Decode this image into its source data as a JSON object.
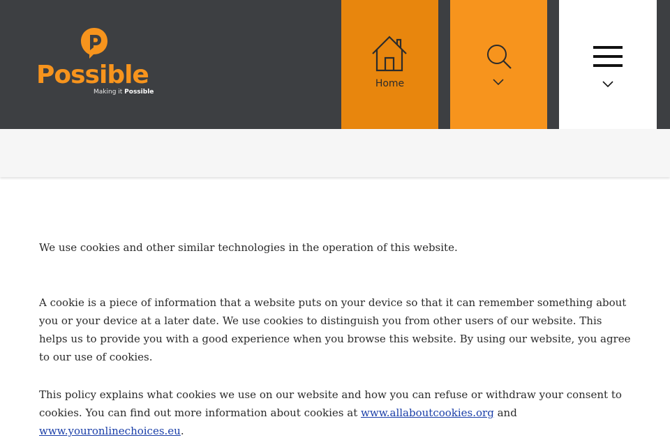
{
  "brand": {
    "name": "Possible",
    "tagline_prefix": "Making it ",
    "tagline_bold": "Possible",
    "color_primary": "#f7941d",
    "color_dark": "#3d3f42"
  },
  "nav": {
    "home_label": "Home",
    "home_icon": "house-icon",
    "search_icon": "search-icon",
    "menu_icon": "hamburger-menu-icon"
  },
  "content": {
    "p1": "We use cookies and other similar technologies in the operation of this website.",
    "p2": "A cookie is a piece of information that a website puts on your device so that it can remember something about you or your device at a later date. We use cookies to distinguish you from other users of our website. This helps us to provide you with a good experience when you browse this website. By using our website, you agree to our use of cookies.",
    "p3_start": "This policy explains what cookies we use on our website and how you can refuse or withdraw your consent to cookies. You can find out more information about cookies at ",
    "link1": "www.allaboutcookies.org",
    "p3_and": " and ",
    "link2": "www.youronlinechoices.eu",
    "p3_end": "."
  }
}
